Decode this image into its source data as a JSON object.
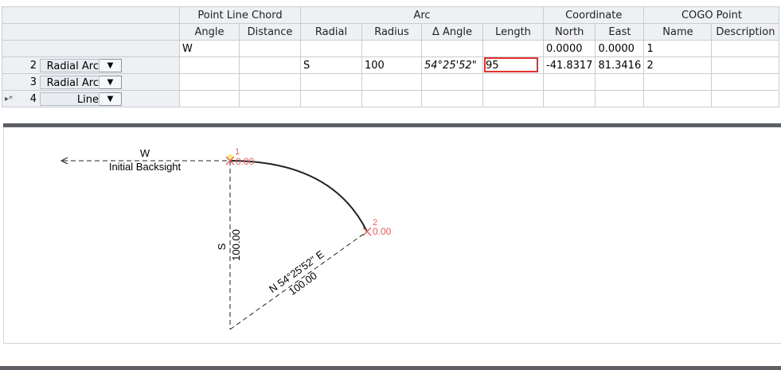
{
  "grid": {
    "group_headers": {
      "point_line_chord": "Point Line Chord",
      "arc": "Arc",
      "coordinate": "Coordinate",
      "cogo_point": "COGO Point"
    },
    "columns": {
      "angle": "Angle",
      "distance": "Distance",
      "radial": "Radial",
      "radius": "Radius",
      "delta_angle": "Δ Angle",
      "length": "Length",
      "north": "North",
      "east": "East",
      "name": "Name",
      "description": "Description"
    },
    "rows": [
      {
        "index": "",
        "type": "",
        "angle": "W",
        "distance": "",
        "radial": "",
        "radius": "",
        "delta_angle": "",
        "length": "",
        "north": "0.0000",
        "east": "0.0000",
        "name": "1",
        "description": ""
      },
      {
        "index": "2",
        "type": "Radial Arc",
        "angle": "",
        "distance": "",
        "radial": "S",
        "radius": "100",
        "delta_angle": "54°25'52\"",
        "length": "95",
        "north": "-41.8317",
        "east": "81.3416",
        "name": "2",
        "description": ""
      },
      {
        "index": "3",
        "type": "Radial Arc",
        "angle": "",
        "distance": "",
        "radial": "",
        "radius": "",
        "delta_angle": "",
        "length": "",
        "north": "",
        "east": "",
        "name": "",
        "description": ""
      },
      {
        "index": "4",
        "type": "Line",
        "angle": "",
        "distance": "",
        "radial": "",
        "radius": "",
        "delta_angle": "",
        "length": "",
        "north": "",
        "east": "",
        "name": "",
        "description": ""
      }
    ],
    "new_row_marker": "▸*",
    "dropdown_glyph": "▼"
  },
  "drawing": {
    "backsight_direction": "W",
    "backsight_label": "Initial Backsight",
    "point1_number": "1",
    "point1_elev": "0.00",
    "point2_number": "2",
    "point2_elev": "0.00",
    "radial_bearing": "S",
    "radial_distance": "100.00",
    "chord_bearing": "N 54°25'52\" E",
    "chord_distance": "100.00",
    "colors": {
      "line": "#222222",
      "point": "#e06060",
      "point_glyph": "#f0d020"
    }
  }
}
